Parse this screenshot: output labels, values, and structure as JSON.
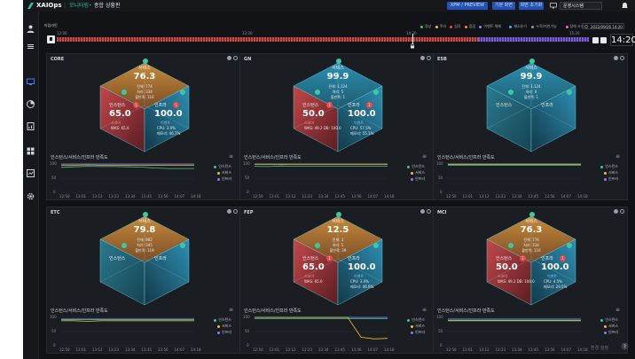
{
  "topbar": {
    "logo": "XAIOps",
    "breadcrumb_menu": "모니터링",
    "breadcrumb_current": "종합 상황판",
    "btn_sync": "XPM / PREVIEW",
    "btn_basic": "기본 화면",
    "btn_fullscreen": "화면 초기화",
    "btn_system": "운영시스템"
  },
  "timeline": {
    "label": "타임라인",
    "time_start": "12:00",
    "time_mid": "13:20",
    "time_now_label": "14:20",
    "time_end": "15:20",
    "datetime": "2022/09/26 14:20",
    "clock": "14:20",
    "legend": [
      {
        "label": "정상",
        "color": "#39c66b"
      },
      {
        "label": "주의",
        "color": "#f2c230"
      },
      {
        "label": "심각",
        "color": "#e84a4a"
      },
      {
        "label": "점검",
        "color": "#ff8c3a"
      },
      {
        "label": "이벤트 해제",
        "color": "#a07cff"
      },
      {
        "label": "재소유기",
        "color": "#38b4f0"
      },
      {
        "label": "누락/지연기능",
        "color": "#8f96a3"
      },
      {
        "label": "장애 조치",
        "color": "#ff5ec4"
      }
    ]
  },
  "chart_axis": {
    "y_ticks": [
      "100",
      "50",
      "0"
    ],
    "x_ticks": [
      "12:50",
      "13:01",
      "13:12",
      "13:23",
      "13:34",
      "13:45",
      "13:56",
      "14:07",
      "14:18"
    ]
  },
  "panels": [
    {
      "name": "CORE",
      "service_label": "서비스",
      "service_score": "76.3",
      "service_lines": [
        "전체: 774",
        "처리: 334",
        "불만족: 116"
      ],
      "left_label": "인스턴스",
      "left_score": "65.0",
      "left_badge": "1",
      "left_sub1": "스코어",
      "left_sub2": "WAS: 65.0",
      "right_label": "인프라",
      "right_score": "100.0",
      "right_badge": "1",
      "right_sub1": "이벤트",
      "right_sub2": "CPU: 3.0%",
      "right_sub3": "메모리: 46.7%",
      "chart_title": "인스턴스/서비스/인프라 만족도",
      "legend": [
        "인스턴스",
        "서비스",
        "인프라"
      ]
    },
    {
      "name": "GN",
      "service_label": "서비스",
      "service_score": "99.9",
      "service_lines": [
        "전체: 1,124",
        "처리: 5",
        "불만족: 1"
      ],
      "left_label": "인스턴스",
      "left_score": "50.0",
      "left_badge": "1",
      "left_sub1": "스코어",
      "left_sub2": "WAS: 49.2 DB: 100.0",
      "right_label": "인프라",
      "right_score": "100.0",
      "right_badge": "1",
      "right_sub1": "이벤트",
      "right_sub2": "CPU: 57.5%",
      "right_sub3": "메모리: 55.1%",
      "chart_title": "인스턴스/서비스/인프라 만족도",
      "legend": [
        "인스턴스",
        "서비스",
        "인프라"
      ]
    },
    {
      "name": "ESB",
      "service_label": "서비스",
      "service_score": "99.9",
      "service_lines": [
        "전체: 1,124",
        "처리: 0",
        "불만족: 1"
      ],
      "left_label": "인스턴스",
      "left_score": "",
      "left_badge": "",
      "left_sub1": "",
      "left_sub2": "",
      "right_label": "인프라",
      "right_score": "",
      "right_badge": "",
      "right_sub1": "",
      "right_sub2": "",
      "right_sub3": "",
      "chart_title": "인스턴스/서비스/인프라 만족도",
      "legend": [
        "인스턴스",
        "서비스",
        "인프라"
      ]
    },
    {
      "name": "ETC",
      "service_label": "서비스",
      "service_score": "79.8",
      "service_lines": [
        "전체: 982",
        "처리: 345",
        "불만족: 119"
      ],
      "left_label": "인스턴스",
      "left_score": "",
      "left_badge": "",
      "left_sub1": "",
      "left_sub2": "",
      "right_label": "인프라",
      "right_score": "",
      "right_badge": "",
      "right_sub1": "",
      "right_sub2": "",
      "right_sub3": "",
      "chart_title": "인스턴스/서비스/인프라 만족도",
      "legend": [
        "인스턴스",
        "서비스",
        "인프라"
      ]
    },
    {
      "name": "FEP",
      "service_label": "서비스",
      "service_score": "12.5",
      "service_lines": [
        "전체: 3",
        "처리: 5",
        "불만족: 39"
      ],
      "left_label": "인스턴스",
      "left_score": "65.0",
      "left_badge": "1",
      "left_sub1": "스코어",
      "left_sub2": "WAS: 65.0",
      "right_label": "인프라",
      "right_score": "100.0",
      "right_badge": "",
      "right_sub1": "이벤트",
      "right_sub2": "CPU: 3.0%",
      "right_sub3": "메모리: 46.9%",
      "chart_title": "인스턴스/서비스/인프라 만족도",
      "legend": [
        "인스턴스",
        "서비스",
        "인프라"
      ]
    },
    {
      "name": "MCI",
      "service_label": "서비스",
      "service_score": "76.3",
      "service_lines": [
        "전체: 774",
        "처리: 334",
        "불만족: 116"
      ],
      "left_label": "인스턴스",
      "left_score": "50.0",
      "left_badge": "1",
      "left_sub1": "스코어",
      "left_sub2": "WAS: 49.2 DB: 100.0",
      "right_label": "인프라",
      "right_score": "100.0",
      "right_badge": "1",
      "right_sub1": "이벤트",
      "right_sub2": "CPU: 4.5%",
      "right_sub3": "메모리: 29.5%",
      "chart_title": "인스턴스/서비스/인프라 만족도",
      "legend": [
        "인스턴스",
        "서비스",
        "인프라"
      ]
    }
  ],
  "footer": {
    "settings": "환경 설정"
  },
  "colors": {
    "instance": "#3ec7a0",
    "service": "#f2c230",
    "infra": "#8a7cff"
  }
}
